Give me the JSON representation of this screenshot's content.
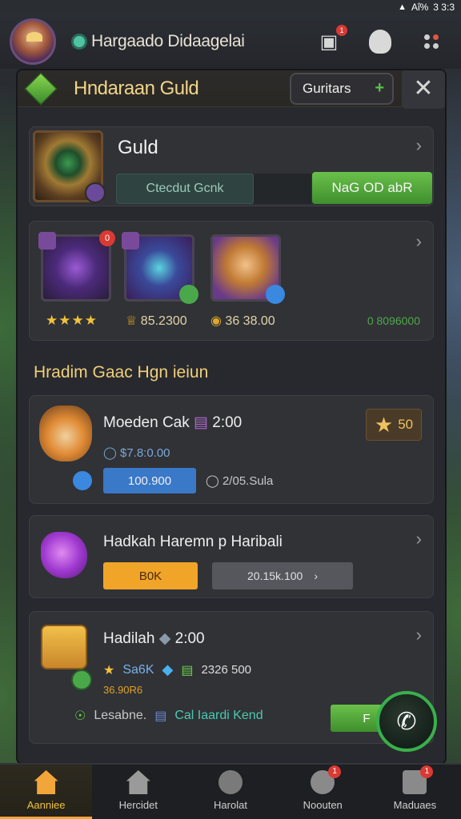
{
  "status_bar": {
    "signal": "▲",
    "battery_text": "Аΐ%",
    "time": "3 3:3"
  },
  "top_bar": {
    "title": "Hargaado Didaagelai",
    "notifications_badge": "1"
  },
  "panel": {
    "title": "Hndaraan Guld",
    "guild_button_label": "Guritars",
    "close_glyph": "✕"
  },
  "guild": {
    "name": "Guld",
    "status_label": "Ctecdut Gcnk",
    "action_label": "NaG OD abR"
  },
  "items": {
    "tile_badge": "0",
    "stars": "★★★★",
    "stat_1": "85.2300",
    "stat_2": "36 38.00",
    "stat_3": "0 8096000"
  },
  "section_title": "Hradim Gaac Hgn ieiun",
  "event_1": {
    "title": "Moeden Cak",
    "time": "2:00",
    "subtitle": "$7.8:0.00",
    "chip_label": "100.900",
    "meta": "2/05.Sula",
    "star_value": "50"
  },
  "event_2": {
    "title": "Hadkah Haremn p Haribali",
    "orange_label": "B0K",
    "gray_label": "20.15k.100"
  },
  "event_3": {
    "title": "Hadilah",
    "time": "2:00",
    "row2_gold": "Sa6K",
    "row2_value": "2326 500",
    "row3": "36.90R6",
    "row4_label": "Lesabne.",
    "row4_link": "Cal Iaardi Kend",
    "button_label": "F"
  },
  "bottom_nav": [
    {
      "label": "Aanniee",
      "badge": ""
    },
    {
      "label": "Hercidet",
      "badge": ""
    },
    {
      "label": "Harolat",
      "badge": ""
    },
    {
      "label": "Noouten",
      "badge": "1"
    },
    {
      "label": "Maduaes",
      "badge": "1"
    }
  ]
}
